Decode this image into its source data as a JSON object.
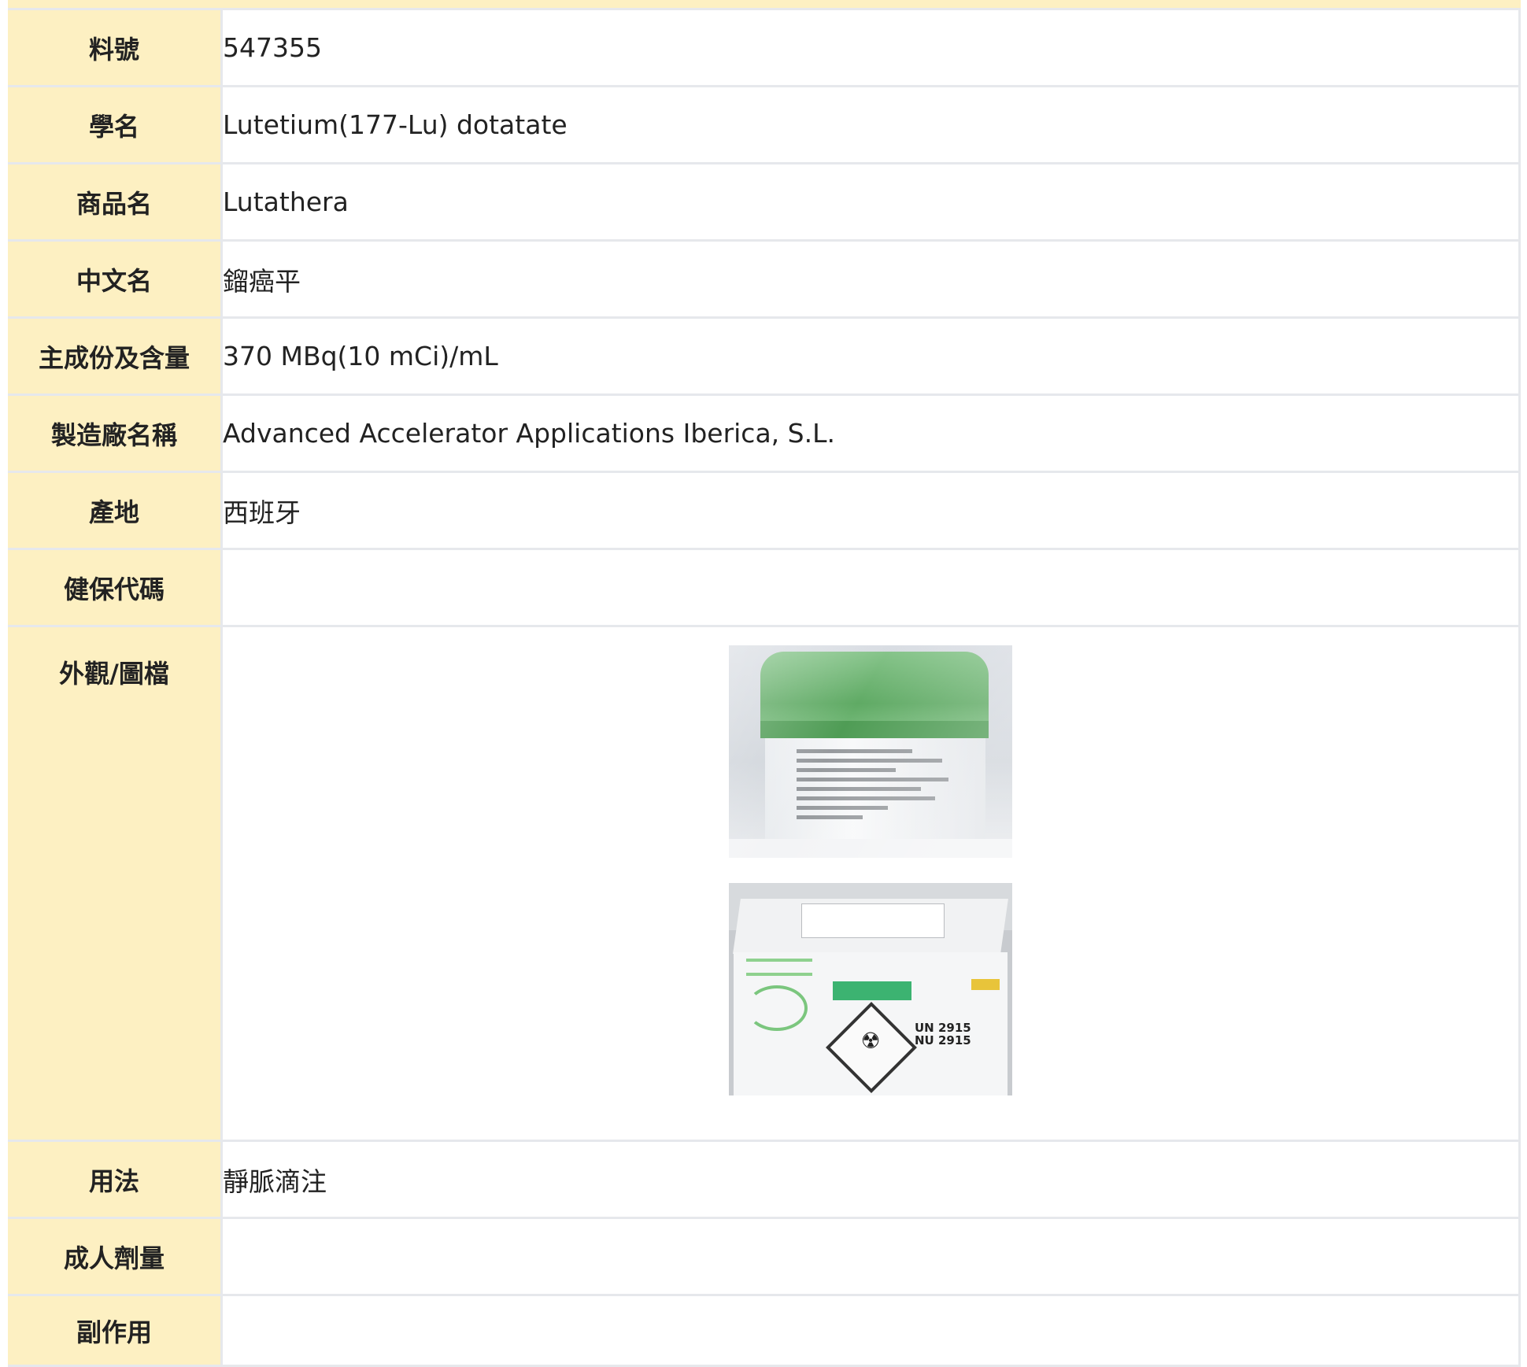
{
  "rows": [
    {
      "label": "料號",
      "value": "547355"
    },
    {
      "label": "學名",
      "value": "Lutetium(177-Lu) dotatate"
    },
    {
      "label": "商品名",
      "value": "Lutathera"
    },
    {
      "label": "中文名",
      "value": "鎦癌平"
    },
    {
      "label": "主成份及含量",
      "value": "370 MBq(10 mCi)/mL"
    },
    {
      "label": "製造廠名稱",
      "value": "Advanced Accelerator Applications Iberica, S.L."
    },
    {
      "label": "產地",
      "value": "西班牙"
    },
    {
      "label": "健保代碼",
      "value": ""
    },
    {
      "label": "外觀/圖檔",
      "value": ""
    },
    {
      "label": "用法",
      "value": "靜脈滴注"
    },
    {
      "label": "成人劑量",
      "value": ""
    },
    {
      "label": "副作用",
      "value": ""
    }
  ],
  "images": [
    {
      "name": "canister-photo"
    },
    {
      "name": "shipping-box-photo",
      "box_text": {
        "un": "UN 2915",
        "nu": "NU 2915",
        "hazard": "RADIOACTIVE I"
      }
    }
  ],
  "colors": {
    "label_bg": "#fdf0c2",
    "border": "#e6e8ec"
  }
}
